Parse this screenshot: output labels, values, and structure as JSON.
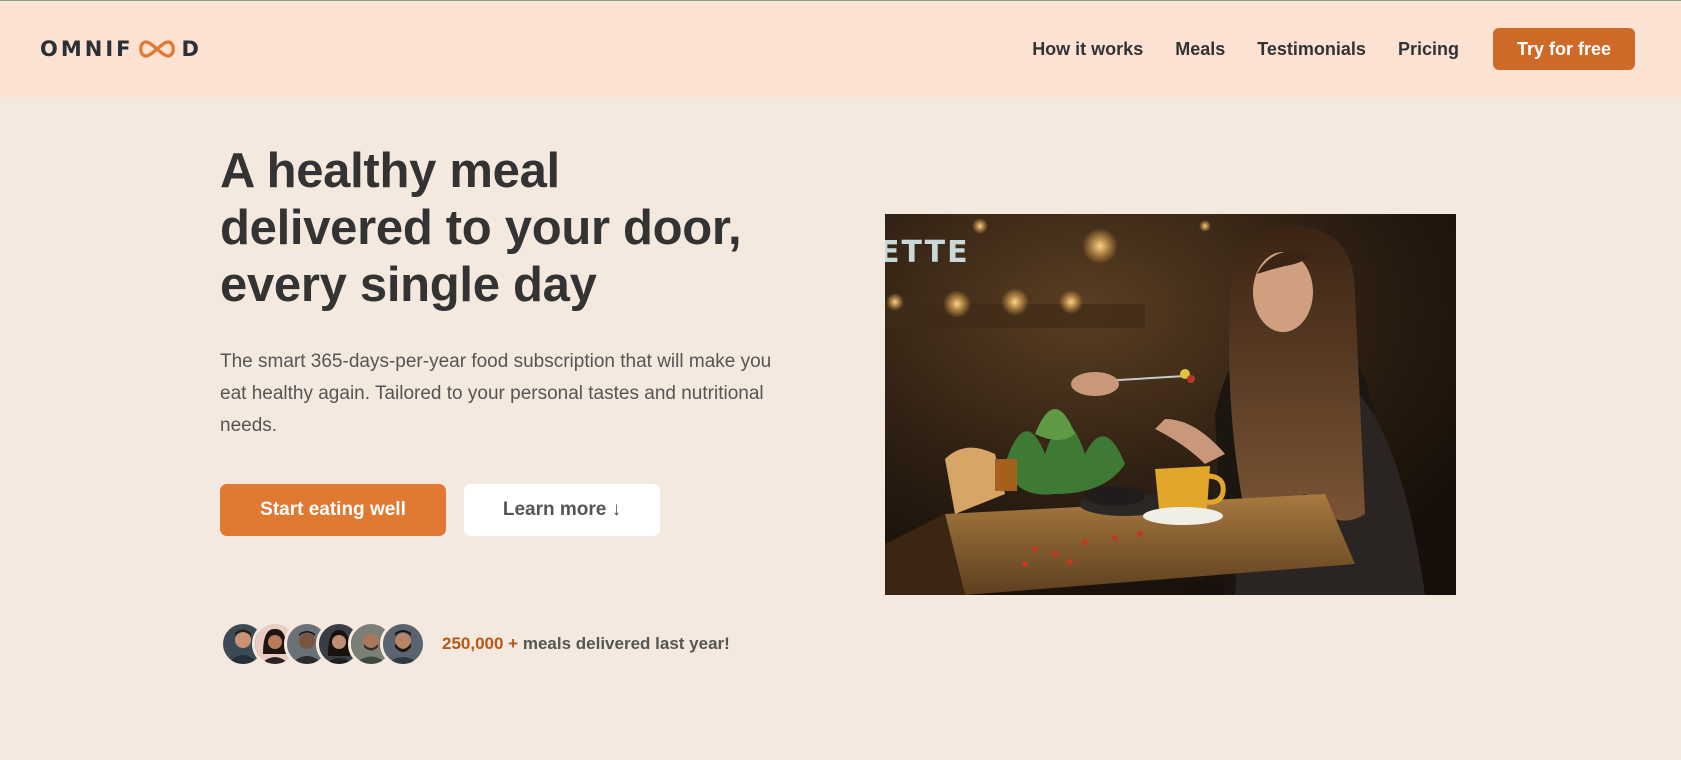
{
  "header": {
    "logo_text_1": "OMNIF",
    "logo_text_2": "D",
    "nav": [
      {
        "label": "How it works"
      },
      {
        "label": "Meals"
      },
      {
        "label": "Testimonials"
      },
      {
        "label": "Pricing"
      }
    ],
    "cta_label": "Try for free"
  },
  "hero": {
    "title_line_1": "A healthy meal",
    "title_line_2": "delivered to your door,",
    "title_line_3": "every single day",
    "description": "The smart 365-days-per-year food subscription that will make you eat healthy again. Tailored to your personal tastes and nutritional needs.",
    "primary_button": "Start eating well",
    "secondary_button": "Learn more ↓"
  },
  "delivered": {
    "count": "250,000 +",
    "text": "meals delivered last year!"
  },
  "image": {
    "sign_text": "ETTE"
  },
  "colors": {
    "accent": "#e07932",
    "header_bg": "#fbe2d2",
    "page_bg": "#f4e9de"
  }
}
